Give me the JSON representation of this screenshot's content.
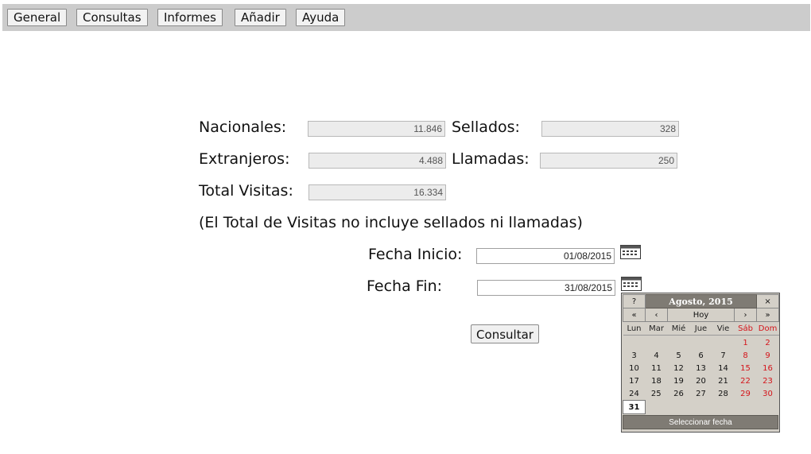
{
  "menu": [
    "General",
    "Consultas",
    "Informes",
    "Añadir",
    "Ayuda"
  ],
  "stats": {
    "nacionales_label": "Nacionales:",
    "nacionales_value": "11.846",
    "sellados_label": "Sellados:",
    "sellados_value": "328",
    "extranjeros_label": "Extranjeros:",
    "extranjeros_value": "4.488",
    "llamadas_label": "Llamadas:",
    "llamadas_value": "250",
    "total_label": "Total Visitas:",
    "total_value": "16.334",
    "note": "(El Total de Visitas no incluye sellados ni llamadas)"
  },
  "dates": {
    "inicio_label": "Fecha Inicio:",
    "inicio_value": "01/08/2015",
    "fin_label": "Fecha Fin:",
    "fin_value": "31/08/2015"
  },
  "consultar_label": "Consultar",
  "calendar": {
    "help": "?",
    "title": "Agosto, 2015",
    "close": "×",
    "prev_year": "«",
    "prev_month": "‹",
    "today": "Hoy",
    "next_month": "›",
    "next_year": "»",
    "weekdays": [
      "Lun",
      "Mar",
      "Mié",
      "Jue",
      "Vie",
      "Sáb",
      "Dom"
    ],
    "weeks": [
      [
        "",
        "",
        "",
        "",
        "",
        "1",
        "2"
      ],
      [
        "3",
        "4",
        "5",
        "6",
        "7",
        "8",
        "9"
      ],
      [
        "10",
        "11",
        "12",
        "13",
        "14",
        "15",
        "16"
      ],
      [
        "17",
        "18",
        "19",
        "20",
        "21",
        "22",
        "23"
      ],
      [
        "24",
        "25",
        "26",
        "27",
        "28",
        "29",
        "30"
      ],
      [
        "31",
        "",
        "",
        "",
        "",
        "",
        ""
      ]
    ],
    "selected": "31",
    "footer": "Seleccionar fecha",
    "weekend_color": "#d4141a"
  }
}
